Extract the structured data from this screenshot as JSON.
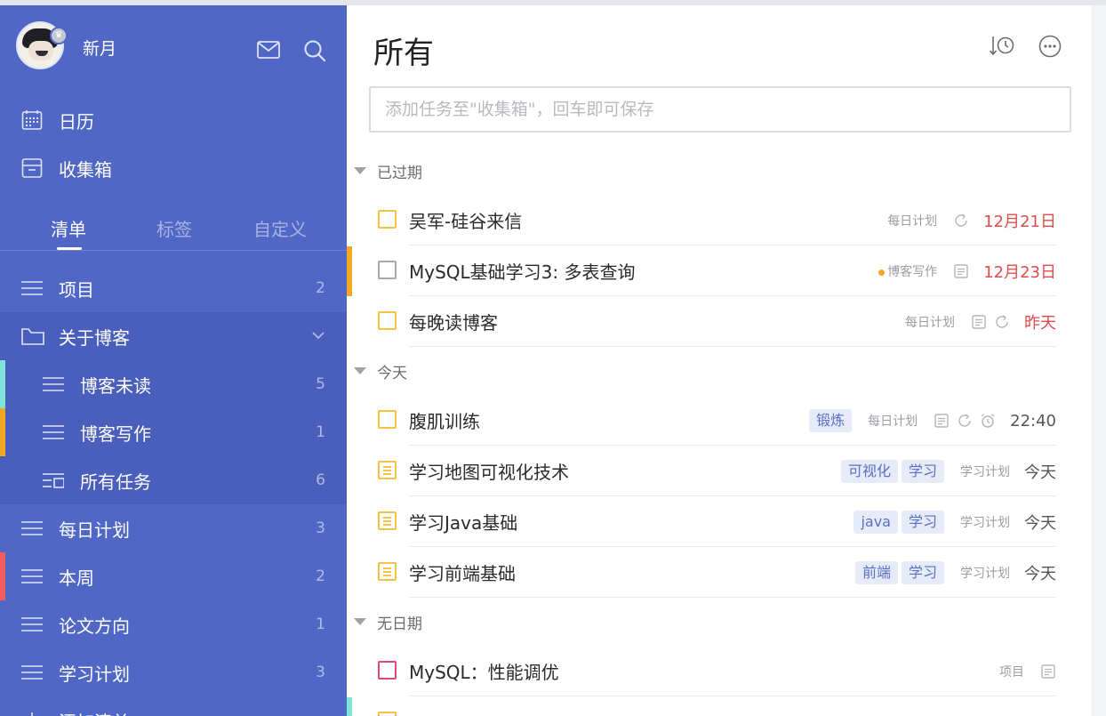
{
  "colors": {
    "sidebar": "#5067c5",
    "accent_orange": "#f5a623",
    "accent_teal": "#7fe3d6",
    "accent_red": "#f25c5c",
    "overdue_red": "#e04b4b",
    "tag_bg": "#e6ebf7"
  },
  "sidebar": {
    "username": "新月",
    "crown_icon": "crown",
    "nav": [
      {
        "label": "日历",
        "icon": "calendar-icon"
      },
      {
        "label": "收集箱",
        "icon": "inbox-icon"
      }
    ],
    "tabs": [
      {
        "label": "清单",
        "active": true
      },
      {
        "label": "标签",
        "active": false
      },
      {
        "label": "自定义",
        "active": false
      }
    ],
    "lists": [
      {
        "label": "项目",
        "count": "2",
        "icon": "list-icon"
      },
      {
        "label": "关于博客",
        "count": "",
        "icon": "folder-icon",
        "expanded": true
      },
      {
        "label": "博客未读",
        "count": "5",
        "icon": "list-icon",
        "accent": "#7fe3d6"
      },
      {
        "label": "博客写作",
        "count": "1",
        "icon": "list-icon",
        "accent": "#f5a623"
      },
      {
        "label": "所有任务",
        "count": "6",
        "icon": "folder-summary-icon"
      },
      {
        "label": "每日计划",
        "count": "3",
        "icon": "list-icon"
      },
      {
        "label": "本周",
        "count": "2",
        "icon": "list-icon",
        "accent": "#f25c5c"
      },
      {
        "label": "论文方向",
        "count": "1",
        "icon": "list-icon"
      },
      {
        "label": "学习计划",
        "count": "3",
        "icon": "list-icon"
      },
      {
        "label": "添加清单",
        "count": "",
        "icon": "plus-icon"
      }
    ]
  },
  "main": {
    "title": "所有",
    "add_placeholder": "添加任务至\"收集箱\"，回车即可保存",
    "sections": [
      {
        "label": "已过期",
        "tasks": [
          {
            "title": "吴军-硅谷来信",
            "tags": [],
            "list": "每日计划",
            "icons": [
              "repeat-icon"
            ],
            "date": "12月21日",
            "date_style": "red",
            "checkbox": "yellow"
          },
          {
            "title": "MySQL基础学习3: 多表查询",
            "tags": [],
            "list": "博客写作",
            "list_dot": true,
            "icons": [
              "note-icon"
            ],
            "date": "12月23日",
            "date_style": "red",
            "checkbox": "gray",
            "accent": "#f5a623"
          },
          {
            "title": "每晚读博客",
            "tags": [],
            "list": "每日计划",
            "icons": [
              "note-icon",
              "repeat-icon"
            ],
            "date": "昨天",
            "date_style": "red",
            "checkbox": "yellow"
          }
        ]
      },
      {
        "label": "今天",
        "tasks": [
          {
            "title": "腹肌训练",
            "tags": [
              "锻炼"
            ],
            "list": "每日计划",
            "icons": [
              "note-icon",
              "repeat-icon",
              "alarm-icon"
            ],
            "date": "22:40",
            "date_style": "normal",
            "checkbox": "yellow"
          },
          {
            "title": "学习地图可视化技术",
            "tags": [
              "可视化",
              "学习"
            ],
            "list": "学习计划",
            "icons": [],
            "date": "今天",
            "date_style": "normal",
            "checkbox": "note"
          },
          {
            "title": "学习Java基础",
            "tags": [
              "java",
              "学习"
            ],
            "list": "学习计划",
            "icons": [],
            "date": "今天",
            "date_style": "normal",
            "checkbox": "note"
          },
          {
            "title": "学习前端基础",
            "tags": [
              "前端",
              "学习"
            ],
            "list": "学习计划",
            "icons": [],
            "date": "今天",
            "date_style": "normal",
            "checkbox": "note"
          }
        ]
      },
      {
        "label": "无日期",
        "tasks": [
          {
            "title": "MySQL：性能调优",
            "tags": [],
            "list": "项目",
            "icons": [
              "note-icon"
            ],
            "date": "",
            "date_style": "normal",
            "checkbox": "pink"
          }
        ]
      }
    ]
  }
}
